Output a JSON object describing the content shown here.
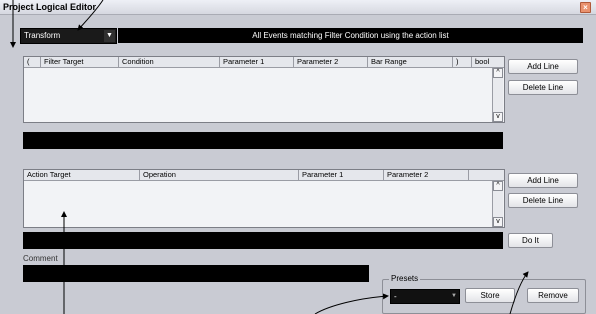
{
  "window": {
    "title": "Project Logical Editor"
  },
  "header": {
    "function_value": "Transform",
    "info_text": "All Events matching Filter Condition using the action list"
  },
  "filter_table": {
    "columns": [
      "(",
      "Filter Target",
      "Condition",
      "Parameter 1",
      "Parameter 2",
      "Bar Range",
      ")",
      "bool"
    ],
    "add_label": "Add Line",
    "delete_label": "Delete Line"
  },
  "action_table": {
    "columns": [
      "Action Target",
      "Operation",
      "Parameter 1",
      "Parameter 2"
    ],
    "add_label": "Add Line",
    "delete_label": "Delete Line"
  },
  "doit_label": "Do It",
  "comment": {
    "label": "Comment",
    "value": ""
  },
  "presets": {
    "title": "Presets",
    "selected": "-",
    "store_label": "Store",
    "remove_label": "Remove"
  },
  "colors": {
    "window_bg": "#c9cbd3",
    "field_black": "#000000",
    "table_bg": "#f2f3f6"
  }
}
